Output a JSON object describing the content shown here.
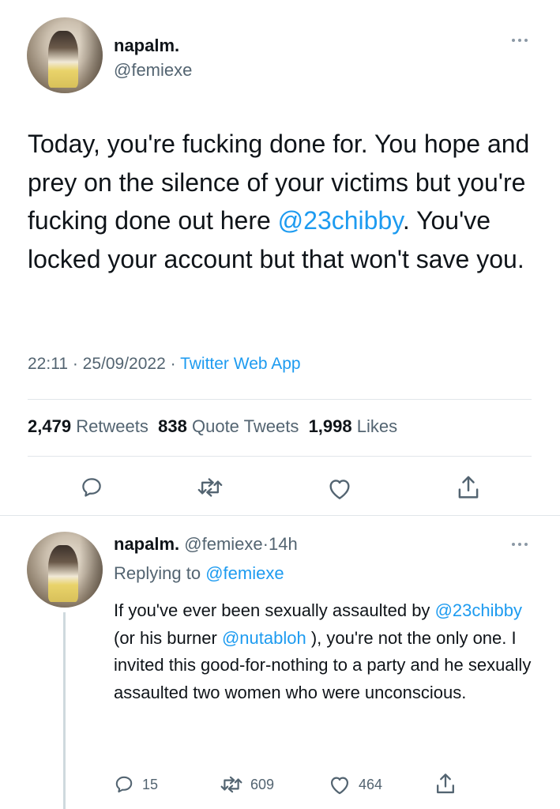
{
  "main_tweet": {
    "author": {
      "display_name": "napalm.",
      "handle": "@femiexe"
    },
    "text_before": "Today, you're fucking done for. You hope and prey on the silence of your victims but you're fucking done out here ",
    "mention": "@23chibby",
    "text_after": ". You've locked your account but that won't save you.",
    "time": "22:11",
    "date": "25/09/2022",
    "separator": " · ",
    "source": "Twitter Web App",
    "stats": {
      "retweets_count": "2,479",
      "retweets_label": "Retweets",
      "quotes_count": "838",
      "quotes_label": "Quote Tweets",
      "likes_count": "1,998",
      "likes_label": "Likes"
    },
    "actions": [
      "reply-icon",
      "retweet-icon",
      "like-icon",
      "share-icon"
    ]
  },
  "reply_tweet": {
    "author": {
      "display_name": "napalm.",
      "handle": "@femiexe",
      "age": "14h"
    },
    "dot": "·",
    "replying_label": "Replying to ",
    "replying_handle": "@femiexe",
    "text_part1": "If you've ever been sexually assaulted by ",
    "mention1": "@23chibby",
    "text_part2": " (or his burner ",
    "mention2": "@nutabloh",
    "text_part3": " ), you're not the only one. I invited this good-for-nothing to a party and he sexually assaulted two women who were unconscious.",
    "actions": {
      "replies": "15",
      "retweets": "609",
      "likes": "464"
    }
  },
  "colors": {
    "text": "#0f1419",
    "secondary": "#536471",
    "accent": "#1d9bf0",
    "divider": "#e1e6ea"
  }
}
